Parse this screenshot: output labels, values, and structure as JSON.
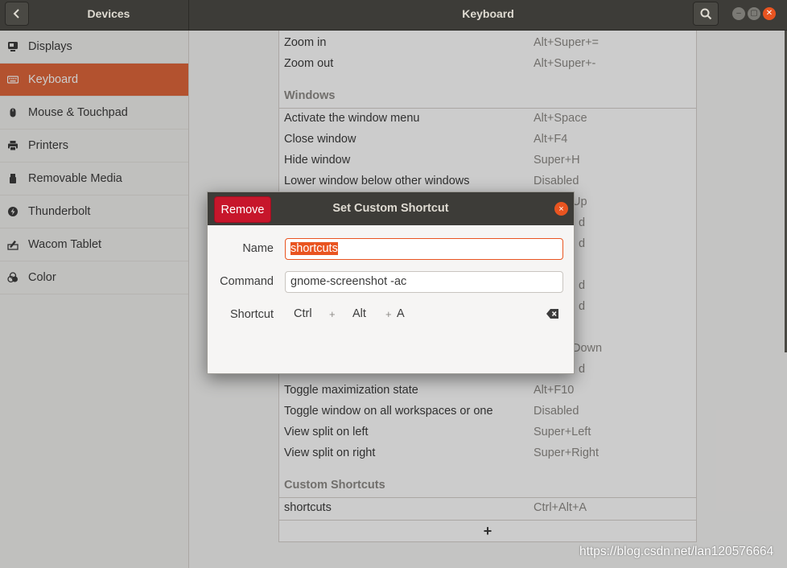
{
  "header": {
    "left_title": "Devices",
    "main_title": "Keyboard"
  },
  "sidebar": {
    "items": [
      {
        "label": "Displays",
        "icon": "display-icon"
      },
      {
        "label": "Keyboard",
        "icon": "keyboard-icon",
        "active": true
      },
      {
        "label": "Mouse & Touchpad",
        "icon": "mouse-icon"
      },
      {
        "label": "Printers",
        "icon": "printer-icon"
      },
      {
        "label": "Removable Media",
        "icon": "usb-icon"
      },
      {
        "label": "Thunderbolt",
        "icon": "thunderbolt-icon"
      },
      {
        "label": "Wacom Tablet",
        "icon": "tablet-icon"
      },
      {
        "label": "Color",
        "icon": "color-icon"
      }
    ]
  },
  "shortcuts": {
    "top_rows": [
      {
        "name": "Zoom in",
        "key": "Alt+Super+="
      },
      {
        "name": "Zoom out",
        "key": "Alt+Super+-"
      }
    ],
    "windows_title": "Windows",
    "windows_rows": [
      {
        "name": "Activate the window menu",
        "key": "Alt+Space"
      },
      {
        "name": "Close window",
        "key": "Alt+F4"
      },
      {
        "name": "Hide window",
        "key": "Super+H"
      },
      {
        "name": "Lower window below other windows",
        "key": "Disabled"
      }
    ],
    "hidden_keys": [
      "Up",
      "d",
      "d",
      "d",
      "d",
      "Down",
      "d"
    ],
    "bottom_rows": [
      {
        "name": "Toggle maximization state",
        "key": "Alt+F10"
      },
      {
        "name": "Toggle window on all workspaces or one",
        "key": "Disabled"
      },
      {
        "name": "View split on left",
        "key": "Super+Left"
      },
      {
        "name": "View split on right",
        "key": "Super+Right"
      }
    ],
    "custom_title": "Custom Shortcuts",
    "custom_rows": [
      {
        "name": "shortcuts",
        "key": "Ctrl+Alt+A"
      }
    ],
    "add_label": "+"
  },
  "dialog": {
    "title": "Set Custom Shortcut",
    "remove_label": "Remove",
    "close_label": "×",
    "name_label": "Name",
    "name_value": "shortcuts",
    "command_label": "Command",
    "command_value": "gnome-screenshot -ac",
    "shortcut_label": "Shortcut",
    "shortcut_keys": [
      "Ctrl",
      "Alt",
      "A"
    ],
    "plus": "+"
  },
  "watermark": "https://blog.csdn.net/lan120576664",
  "colors": {
    "accent": "#e95420",
    "active_row": "#e0673b",
    "remove": "#c7162b",
    "header": "#3d3c38"
  }
}
